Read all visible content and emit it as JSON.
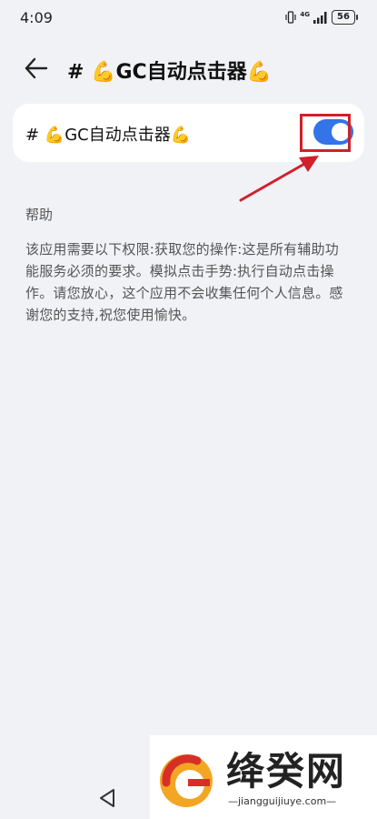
{
  "status_bar": {
    "time": "4:09",
    "network": "4G",
    "battery": "56"
  },
  "header": {
    "title": "# 💪GC自动点击器💪",
    "back_icon": "arrow-left-icon"
  },
  "service": {
    "label": "# 💪GC自动点击器💪",
    "enabled": true,
    "toggle_color": "#3374e8"
  },
  "annotation": {
    "highlight_color": "#d0202a"
  },
  "help": {
    "title": "帮助",
    "text": "该应用需要以下权限:获取您的操作:这是所有辅助功能服务必须的要求。模拟点击手势:执行自动点击操作。请您放心，这个应用不会收集任何个人信息。感谢您的支持,祝您使用愉快。"
  },
  "nav": {
    "back_icon": "triangle-back-icon"
  },
  "watermark": {
    "name": "绛癸网",
    "url": "—jiangguijiuye.com—"
  }
}
